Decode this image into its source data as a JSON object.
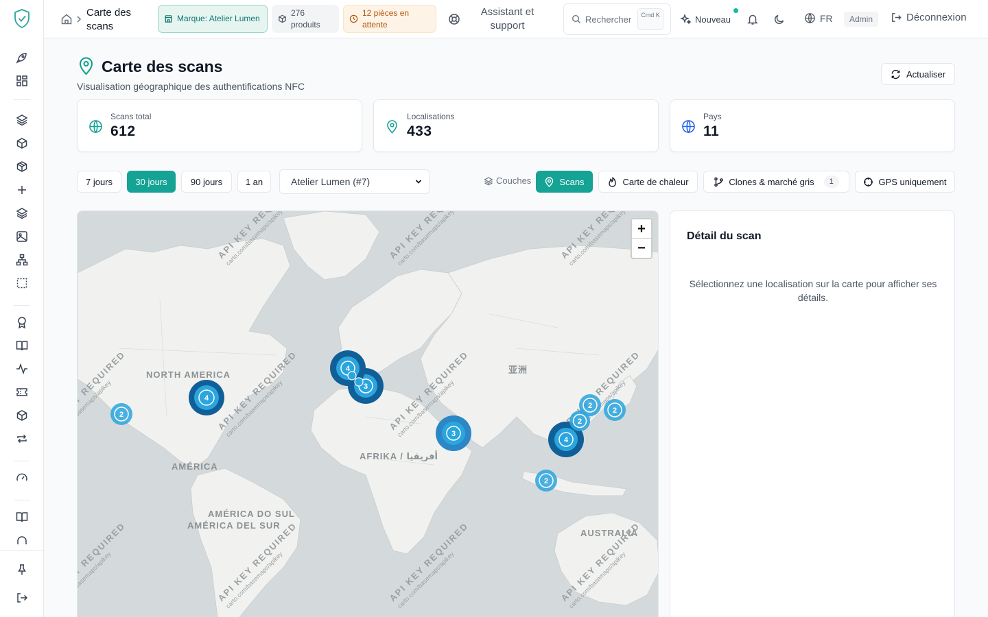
{
  "header": {
    "breadcrumb_title": "Carte des scans",
    "brand_pill": "Marque: Atelier Lumen",
    "products_pill": "276 produits",
    "pending_pill": "12 pièces en attente",
    "assistant": "Assistant et support",
    "search_placeholder": "Rechercher",
    "search_shortcut": "Cmd K",
    "new_label": "Nouveau",
    "language": "FR",
    "role": "Admin",
    "logout": "Déconnexion"
  },
  "page": {
    "title": "Carte des scans",
    "subtitle": "Visualisation géographique des authentifications NFC",
    "refresh_label": "Actualiser"
  },
  "stats": [
    {
      "label": "Scans total",
      "value": "612",
      "icon": "globe-icon",
      "color": "#14a394"
    },
    {
      "label": "Localisations",
      "value": "433",
      "icon": "map-pin-icon",
      "color": "#14a394"
    },
    {
      "label": "Pays",
      "value": "11",
      "icon": "globe-icon",
      "color": "#2563eb"
    }
  ],
  "filters": {
    "periods": [
      "7 jours",
      "30 jours",
      "90 jours",
      "1 an"
    ],
    "active_period": "30 jours",
    "brand_select": "Atelier Lumen (#7)",
    "layers_label": "Couches",
    "layers": [
      {
        "label": "Scans",
        "active": true
      },
      {
        "label": "Carte de chaleur",
        "active": false
      },
      {
        "label": "Clones & marché gris",
        "active": false,
        "badge": "1"
      },
      {
        "label": "GPS uniquement",
        "active": false
      }
    ]
  },
  "map": {
    "labels": [
      "NORTH AMERICA",
      "AMÉRICA",
      "AMÉRICA DO SUL",
      "AMÉRICA DEL SUR",
      "AFRIKA / أفريقيا",
      "亚洲",
      "AUSTRALIA"
    ],
    "watermark": "API KEY REQUIRED",
    "watermark_url": "carto.com/basemaps/apikey",
    "zoom_in": "+",
    "zoom_out": "−",
    "clusters": [
      {
        "count": "2",
        "region": "west-us"
      },
      {
        "count": "4",
        "region": "east-us"
      },
      {
        "count": "4",
        "region": "west-europe"
      },
      {
        "count": "3",
        "region": "central-europe"
      },
      {
        "count": "3",
        "region": "middle-east"
      },
      {
        "count": "2",
        "region": "east-china"
      },
      {
        "count": "2",
        "region": "south-china"
      },
      {
        "count": "2",
        "region": "japan"
      },
      {
        "count": "4",
        "region": "southeast-asia"
      },
      {
        "count": "2",
        "region": "indonesia"
      }
    ]
  },
  "detail": {
    "title": "Détail du scan",
    "empty_message": "Sélectionnez une localisation sur la carte pour afficher ses détails."
  },
  "colors": {
    "accent": "#14a394",
    "cluster_light": "#2ba5de",
    "cluster_mid": "#2b87c6",
    "cluster_dark": "#115f98"
  }
}
